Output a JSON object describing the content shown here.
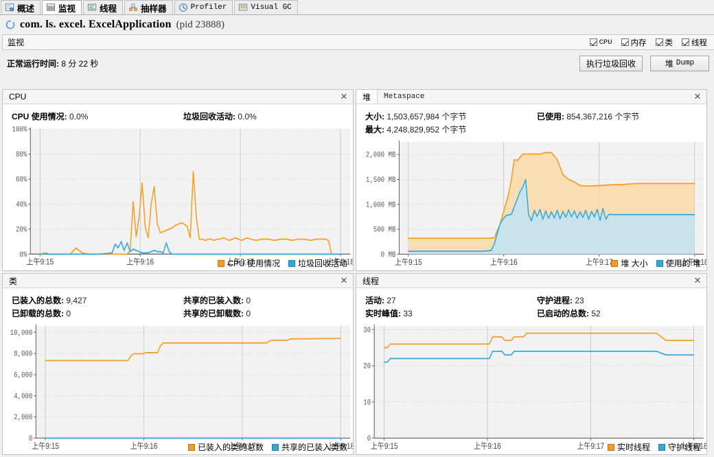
{
  "tabs": [
    {
      "label": "概述",
      "icon": "overview-icon",
      "active": false,
      "mono": false
    },
    {
      "label": "监视",
      "icon": "monitor-icon",
      "active": true,
      "mono": false
    },
    {
      "label": "线程",
      "icon": "threads-icon",
      "active": false,
      "mono": false
    },
    {
      "label": "抽样器",
      "icon": "sampler-icon",
      "active": false,
      "mono": false
    },
    {
      "label": "Profiler",
      "icon": "profiler-clock-icon",
      "active": false,
      "mono": true
    },
    {
      "label": "Visual GC",
      "icon": "visualgc-icon",
      "active": false,
      "mono": true
    }
  ],
  "app": {
    "title": "com. ls. excel. ExcelApplication",
    "pid_text": "(pid 23888)",
    "spinner_icon": "loading-spinner-icon"
  },
  "monitor_bar": {
    "title": "监视",
    "checkboxes": [
      {
        "label": "CPU",
        "checked": true,
        "mono": true
      },
      {
        "label": "内存",
        "checked": true,
        "mono": false
      },
      {
        "label": "类",
        "checked": true,
        "mono": false
      },
      {
        "label": "线程",
        "checked": true,
        "mono": false
      }
    ]
  },
  "uptime": {
    "label": "正常运行时间:",
    "value": "8 分 22 秒"
  },
  "toolbar": {
    "gc_button": "执行垃圾回收",
    "heapdump_button_cn": "堆",
    "heapdump_button_en": "Dump"
  },
  "colors": {
    "orange": "#f89c20",
    "orange_fill": "#fad9a8",
    "blue": "#31a8dd",
    "blue_fill": "#bfe4f5",
    "plot_bg": "#f2f2f2",
    "grid": "#cccccc"
  },
  "panels": {
    "cpu": {
      "title": "CPU",
      "close_icon": "close-icon",
      "stats": [
        {
          "label": "CPU 使用情况:",
          "value": "0.0%"
        },
        {
          "label": "垃圾回收活动:",
          "value": "0.0%"
        }
      ],
      "legend": [
        {
          "label": "CPU 使用情况",
          "color": "#f89c20"
        },
        {
          "label": "垃圾回收活动",
          "color": "#31a8dd"
        }
      ]
    },
    "heap": {
      "tab_active": "堆",
      "tab_inactive": "Metaspace",
      "close_icon": "close-icon",
      "stats": [
        {
          "label": "大小:",
          "value": "1,503,657,984 个字节"
        },
        {
          "label": "已使用:",
          "value": "854,367,216 个字节"
        },
        {
          "label": "最大:",
          "value": "4,248,829,952 个字节"
        },
        {
          "label": "",
          "value": ""
        }
      ],
      "legend": [
        {
          "label": "堆 大小",
          "color": "#f89c20"
        },
        {
          "label": "使用的 堆",
          "color": "#31a8dd"
        }
      ]
    },
    "classes": {
      "title": "类",
      "close_icon": "close-icon",
      "stats": [
        {
          "label": "已装入的总数:",
          "value": "9,427"
        },
        {
          "label": "共享的已装入数:",
          "value": "0"
        },
        {
          "label": "已卸载的总数:",
          "value": "0"
        },
        {
          "label": "共享的已卸载数:",
          "value": "0"
        }
      ],
      "legend": [
        {
          "label": "已装入的类的总数",
          "color": "#f89c20"
        },
        {
          "label": "共享的已装入类数",
          "color": "#31a8dd"
        }
      ]
    },
    "threads": {
      "title": "线程",
      "close_icon": "close-icon",
      "stats": [
        {
          "label": "活动:",
          "value": "27"
        },
        {
          "label": "守护进程:",
          "value": "23"
        },
        {
          "label": "实时峰值:",
          "value": "33"
        },
        {
          "label": "已启动的总数:",
          "value": "52"
        }
      ],
      "legend": [
        {
          "label": "实时线程",
          "color": "#f89c20"
        },
        {
          "label": "守护线程",
          "color": "#31a8dd"
        }
      ]
    }
  },
  "chart_data": [
    {
      "id": "cpu",
      "type": "area",
      "title": "CPU",
      "xlabel": "",
      "ylabel": "",
      "ylim": [
        0,
        100
      ],
      "ytick_labels": [
        "0%",
        "20%",
        "40%",
        "60%",
        "80%",
        "100%"
      ],
      "ytick_values": [
        0,
        20,
        40,
        60,
        80,
        100
      ],
      "xtick_labels": [
        "上午9:15",
        "上午9:16",
        "上午9:17",
        "上午9:18"
      ],
      "grid": true,
      "series": [
        {
          "name": "CPU 使用情况",
          "color": "#f89c20",
          "x": [
            0,
            2,
            3,
            4,
            5,
            6,
            8,
            10,
            12,
            14,
            16,
            18,
            19,
            20,
            22,
            24,
            25,
            26,
            27,
            28,
            29,
            30,
            31,
            32,
            33,
            34,
            35,
            36,
            37,
            38,
            39,
            40,
            41,
            42,
            43,
            44,
            45,
            46,
            47,
            48,
            49,
            50,
            51,
            52,
            53,
            54,
            55,
            56,
            57,
            58,
            59,
            60,
            61,
            62,
            63,
            64,
            65,
            66,
            67,
            68,
            69,
            70,
            72,
            74,
            76,
            78,
            80,
            82,
            84,
            86,
            88,
            90,
            92,
            94,
            95,
            96,
            97,
            98,
            100
          ],
          "values": [
            0,
            1,
            0,
            0,
            0,
            0,
            0,
            0,
            5,
            1,
            0,
            0,
            0,
            0,
            0,
            0,
            0,
            0,
            0,
            0,
            0,
            3,
            42,
            14,
            30,
            57,
            22,
            13,
            40,
            54,
            25,
            17,
            18,
            19,
            20,
            21,
            23,
            24,
            25,
            24,
            22,
            13,
            66,
            30,
            12,
            12,
            11,
            12,
            12,
            11,
            12,
            12,
            13,
            12,
            11,
            12,
            13,
            12,
            11,
            12,
            13,
            12,
            11,
            12,
            12,
            11,
            12,
            12,
            11,
            12,
            12,
            11,
            12,
            12,
            12,
            11,
            0,
            0,
            0
          ]
        },
        {
          "name": "垃圾回收活动",
          "color": "#31a8dd",
          "x": [
            0,
            20,
            24,
            25,
            26,
            27,
            28,
            29,
            30,
            31,
            32,
            33,
            34,
            35,
            36,
            37,
            38,
            39,
            40,
            41,
            42,
            43,
            44,
            45,
            46,
            48,
            50,
            60,
            70,
            80,
            90,
            100
          ],
          "values": [
            0,
            0,
            1,
            8,
            5,
            10,
            3,
            9,
            2,
            4,
            3,
            2,
            1,
            1,
            1,
            2,
            3,
            2,
            2,
            1,
            9,
            2,
            0,
            0,
            0,
            0,
            0,
            0,
            0,
            0,
            0,
            0
          ]
        }
      ]
    },
    {
      "id": "heap",
      "type": "area",
      "title": "堆",
      "ylim": [
        0,
        2250
      ],
      "ytick_labels": [
        "0 MB",
        "500 MB",
        "1,000 MB",
        "1,500 MB",
        "2,000 MB"
      ],
      "ytick_values": [
        0,
        500,
        1000,
        1500,
        2000
      ],
      "xtick_labels": [
        "上午9:15",
        "上午9:16",
        "上午9:17",
        "上午9:18"
      ],
      "grid": true,
      "series": [
        {
          "name": "堆 大小",
          "color": "#f89c20",
          "x": [
            0,
            28,
            30,
            32,
            34,
            35,
            36,
            37,
            38,
            40,
            42,
            44,
            46,
            48,
            50,
            52,
            54,
            56,
            58,
            60,
            62,
            64,
            66,
            70,
            75,
            80,
            85,
            90,
            95,
            100
          ],
          "values": [
            320,
            320,
            330,
            600,
            1000,
            1200,
            1500,
            1900,
            1880,
            2010,
            2010,
            2010,
            2010,
            2040,
            2040,
            1900,
            1600,
            1500,
            1450,
            1380,
            1370,
            1370,
            1375,
            1390,
            1400,
            1420,
            1420,
            1420,
            1420,
            1420
          ]
        },
        {
          "name": "使用的 堆",
          "color": "#31a8dd",
          "x": [
            0,
            26,
            28,
            29,
            30,
            31,
            32,
            33,
            34,
            35,
            36,
            37,
            38,
            39,
            40,
            41,
            42,
            43,
            44,
            45,
            46,
            47,
            48,
            49,
            50,
            51,
            52,
            53,
            54,
            55,
            56,
            57,
            58,
            59,
            60,
            61,
            62,
            63,
            64,
            65,
            66,
            67,
            68,
            69,
            70,
            72,
            74,
            76,
            78,
            80,
            82,
            84,
            86,
            88,
            90,
            92,
            94,
            96,
            98,
            100
          ],
          "values": [
            60,
            60,
            70,
            80,
            200,
            400,
            600,
            700,
            770,
            790,
            800,
            950,
            1100,
            1250,
            1350,
            1500,
            800,
            670,
            880,
            760,
            900,
            700,
            870,
            720,
            850,
            730,
            880,
            710,
            860,
            740,
            890,
            750,
            870,
            720,
            850,
            740,
            880,
            700,
            860,
            750,
            900,
            680,
            920,
            700,
            800,
            795,
            795,
            795,
            795,
            795,
            795,
            795,
            795,
            795,
            795,
            795,
            795,
            795,
            795,
            795
          ]
        }
      ]
    },
    {
      "id": "classes",
      "type": "line",
      "title": "类",
      "ylim": [
        0,
        10600
      ],
      "ytick_labels": [
        "0",
        "2,000",
        "4,000",
        "6,000",
        "8,000",
        "10,000"
      ],
      "ytick_values": [
        0,
        2000,
        4000,
        6000,
        8000,
        10000
      ],
      "xtick_labels": [
        "上午9:15",
        "上午9:16",
        "上午9:17",
        "上午9:18"
      ],
      "grid": true,
      "series": [
        {
          "name": "已装入的类的总数",
          "color": "#f89c20",
          "x": [
            0,
            28,
            29,
            30,
            33,
            34,
            38,
            39,
            40,
            75,
            76,
            77,
            82,
            83,
            100
          ],
          "values": [
            7330,
            7330,
            7800,
            7980,
            7980,
            8080,
            8080,
            8750,
            9000,
            9000,
            9200,
            9250,
            9250,
            9380,
            9420
          ]
        },
        {
          "name": "共享的已装入类数",
          "color": "#31a8dd",
          "x": [
            0,
            100
          ],
          "values": [
            0,
            0
          ]
        }
      ]
    },
    {
      "id": "threads",
      "type": "line",
      "title": "线程",
      "ylim": [
        0,
        31
      ],
      "ytick_labels": [
        "0",
        "10",
        "20",
        "30"
      ],
      "ytick_values": [
        0,
        10,
        20,
        30
      ],
      "xtick_labels": [
        "上午9:15",
        "上午9:16",
        "上午9:17",
        "上午9:18"
      ],
      "grid": true,
      "series": [
        {
          "name": "实时线程",
          "color": "#f89c20",
          "x": [
            0,
            1,
            2,
            3,
            34,
            35,
            38,
            39,
            41,
            42,
            45,
            46,
            87,
            88,
            91,
            92,
            100
          ],
          "values": [
            25,
            25,
            26,
            26,
            26,
            28,
            28,
            27,
            27,
            28,
            28,
            29,
            29,
            29,
            27,
            27,
            27
          ]
        },
        {
          "name": "守护线程",
          "color": "#31a8dd",
          "x": [
            0,
            1,
            2,
            3,
            34,
            35,
            38,
            39,
            41,
            42,
            45,
            46,
            87,
            88,
            91,
            92,
            100
          ],
          "values": [
            21,
            21,
            22,
            22,
            22,
            24,
            24,
            23,
            23,
            24,
            24,
            24,
            24,
            24,
            23,
            23,
            23
          ]
        }
      ]
    }
  ]
}
